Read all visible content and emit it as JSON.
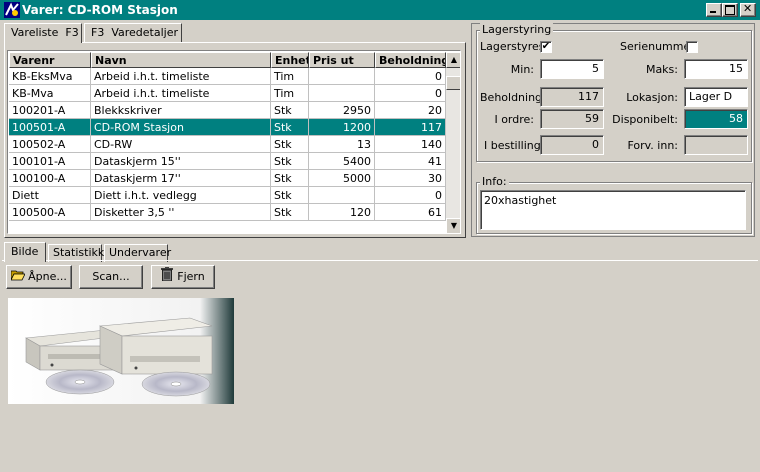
{
  "window": {
    "title": "Varer: CD-ROM Stasjon"
  },
  "top_tabs": [
    {
      "label": "Vareliste  F3",
      "active": true
    },
    {
      "label": "F3  Varedetaljer",
      "active": false
    }
  ],
  "grid": {
    "columns": [
      "Varenr",
      "Navn",
      "Enhet",
      "Pris ut",
      "Beholdning"
    ],
    "rows": [
      {
        "varenr": "KB-EksMva",
        "navn": "Arbeid i.h.t. timeliste",
        "enhet": "Tim",
        "pris": "",
        "beholdning": "0"
      },
      {
        "varenr": "KB-Mva",
        "navn": "Arbeid i.h.t. timeliste",
        "enhet": "Tim",
        "pris": "",
        "beholdning": "0"
      },
      {
        "varenr": "100201-A",
        "navn": "Blekkskriver",
        "enhet": "Stk",
        "pris": "2950",
        "beholdning": "20"
      },
      {
        "varenr": "100501-A",
        "navn": "CD-ROM Stasjon",
        "enhet": "Stk",
        "pris": "1200",
        "beholdning": "117",
        "selected": true
      },
      {
        "varenr": "100502-A",
        "navn": "CD-RW",
        "enhet": "Stk",
        "pris": "13",
        "beholdning": "140"
      },
      {
        "varenr": "100101-A",
        "navn": "Dataskjerm 15''",
        "enhet": "Stk",
        "pris": "5400",
        "beholdning": "41"
      },
      {
        "varenr": "100100-A",
        "navn": "Dataskjerm 17''",
        "enhet": "Stk",
        "pris": "5000",
        "beholdning": "30"
      },
      {
        "varenr": "Diett",
        "navn": "Diett i.h.t. vedlegg",
        "enhet": "Stk",
        "pris": "",
        "beholdning": "0"
      },
      {
        "varenr": "100500-A",
        "navn": "Disketter 3,5 ''",
        "enhet": "Stk",
        "pris": "120",
        "beholdning": "61"
      }
    ]
  },
  "lagerstyring": {
    "group_title": "Lagerstyring",
    "lagerstyres_label": "Lagerstyres:",
    "lagerstyres_checked": true,
    "serienummer_label": "Serienummer:",
    "serienummer_checked": false,
    "min_label": "Min:",
    "min_value": "5",
    "maks_label": "Maks:",
    "maks_value": "15",
    "beholdning_label": "Beholdning:",
    "beholdning_value": "117",
    "lokasjon_label": "Lokasjon:",
    "lokasjon_value": "Lager D",
    "iordre_label": "I ordre:",
    "iordre_value": "59",
    "disponibelt_label": "Disponibelt:",
    "disponibelt_value": "58",
    "ibestilling_label": "I bestilling:",
    "ibestilling_value": "0",
    "forvinn_label": "Forv. inn:",
    "forvinn_value": ""
  },
  "info": {
    "group_title": "Info:",
    "text": "20xhastighet"
  },
  "lower_tabs": [
    {
      "label": "Bilde",
      "active": true
    },
    {
      "label": "Statistikk",
      "active": false
    },
    {
      "label": "Undervarer",
      "active": false
    }
  ],
  "buttons": {
    "open": "Åpne...",
    "scan": "Scan...",
    "remove": "Fjern"
  },
  "icons": {
    "app": "app-icon",
    "open": "folder-open-icon",
    "remove": "trash-icon",
    "check": "✔"
  },
  "colors": {
    "titlebar": "#008080",
    "selection": "#008080",
    "face": "#d4d0c8"
  }
}
